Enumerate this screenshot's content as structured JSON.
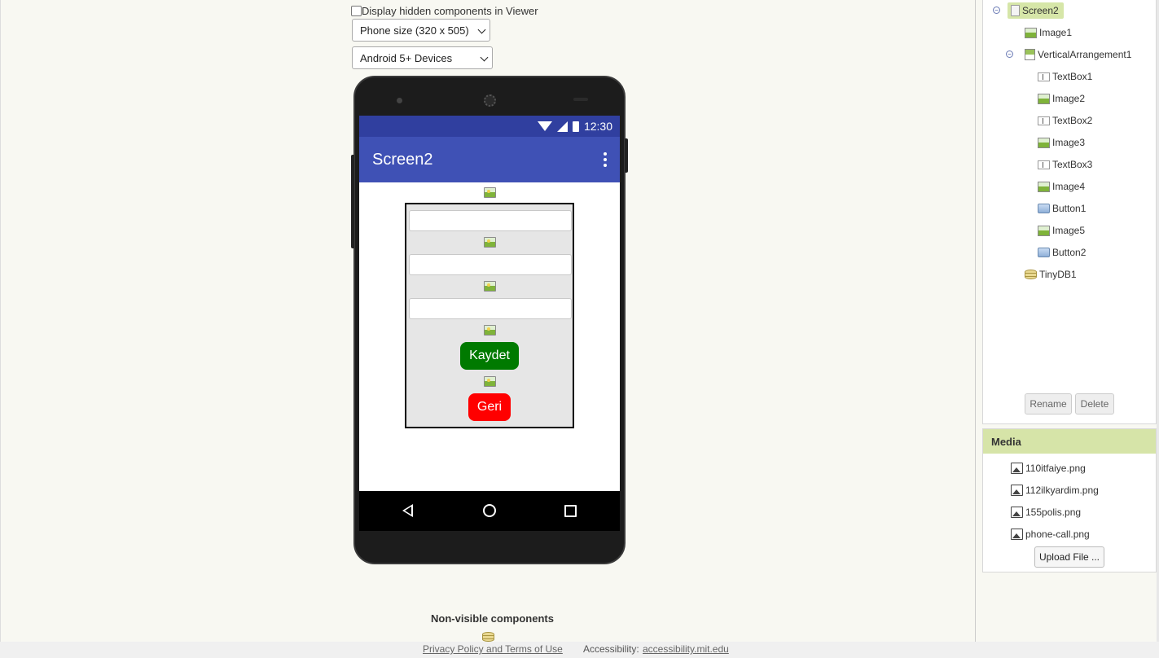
{
  "viewer": {
    "hidden_components_label": "Display hidden components in Viewer",
    "phone_size_select": "Phone size (320 x 505)",
    "device_select": "Android 5+ Devices",
    "non_visible_title": "Non-visible components"
  },
  "phone": {
    "status_time": "12:30",
    "app_title": "Screen2",
    "save_button": "Kaydet",
    "back_button": "Geri",
    "save_button_color": "#007a00",
    "back_button_color": "#ff0000",
    "appbar_color": "#3f51b5",
    "statusbar_color": "#303f9f"
  },
  "components": {
    "screen": "Screen2",
    "items": [
      {
        "label": "Image1",
        "icon": "image-icon"
      },
      {
        "label": "VerticalArrangement1",
        "icon": "vertical-arrangement-icon"
      },
      {
        "label": "TextBox1",
        "icon": "textbox-icon"
      },
      {
        "label": "Image2",
        "icon": "image-icon"
      },
      {
        "label": "TextBox2",
        "icon": "textbox-icon"
      },
      {
        "label": "Image3",
        "icon": "image-icon"
      },
      {
        "label": "TextBox3",
        "icon": "textbox-icon"
      },
      {
        "label": "Image4",
        "icon": "image-icon"
      },
      {
        "label": "Button1",
        "icon": "button-icon"
      },
      {
        "label": "Image5",
        "icon": "image-icon"
      },
      {
        "label": "Button2",
        "icon": "button-icon"
      },
      {
        "label": "TinyDB1",
        "icon": "database-icon"
      }
    ],
    "rename_button": "Rename",
    "delete_button": "Delete"
  },
  "media": {
    "title": "Media",
    "files": [
      "110itfaiye.png",
      "112ilkyardim.png",
      "155polis.png",
      "phone-call.png"
    ],
    "upload_button": "Upload File ..."
  },
  "footer": {
    "privacy_link": "Privacy Policy and Terms of Use",
    "accessibility_label": "Accessibility:",
    "accessibility_link": "accessibility.mit.edu"
  }
}
